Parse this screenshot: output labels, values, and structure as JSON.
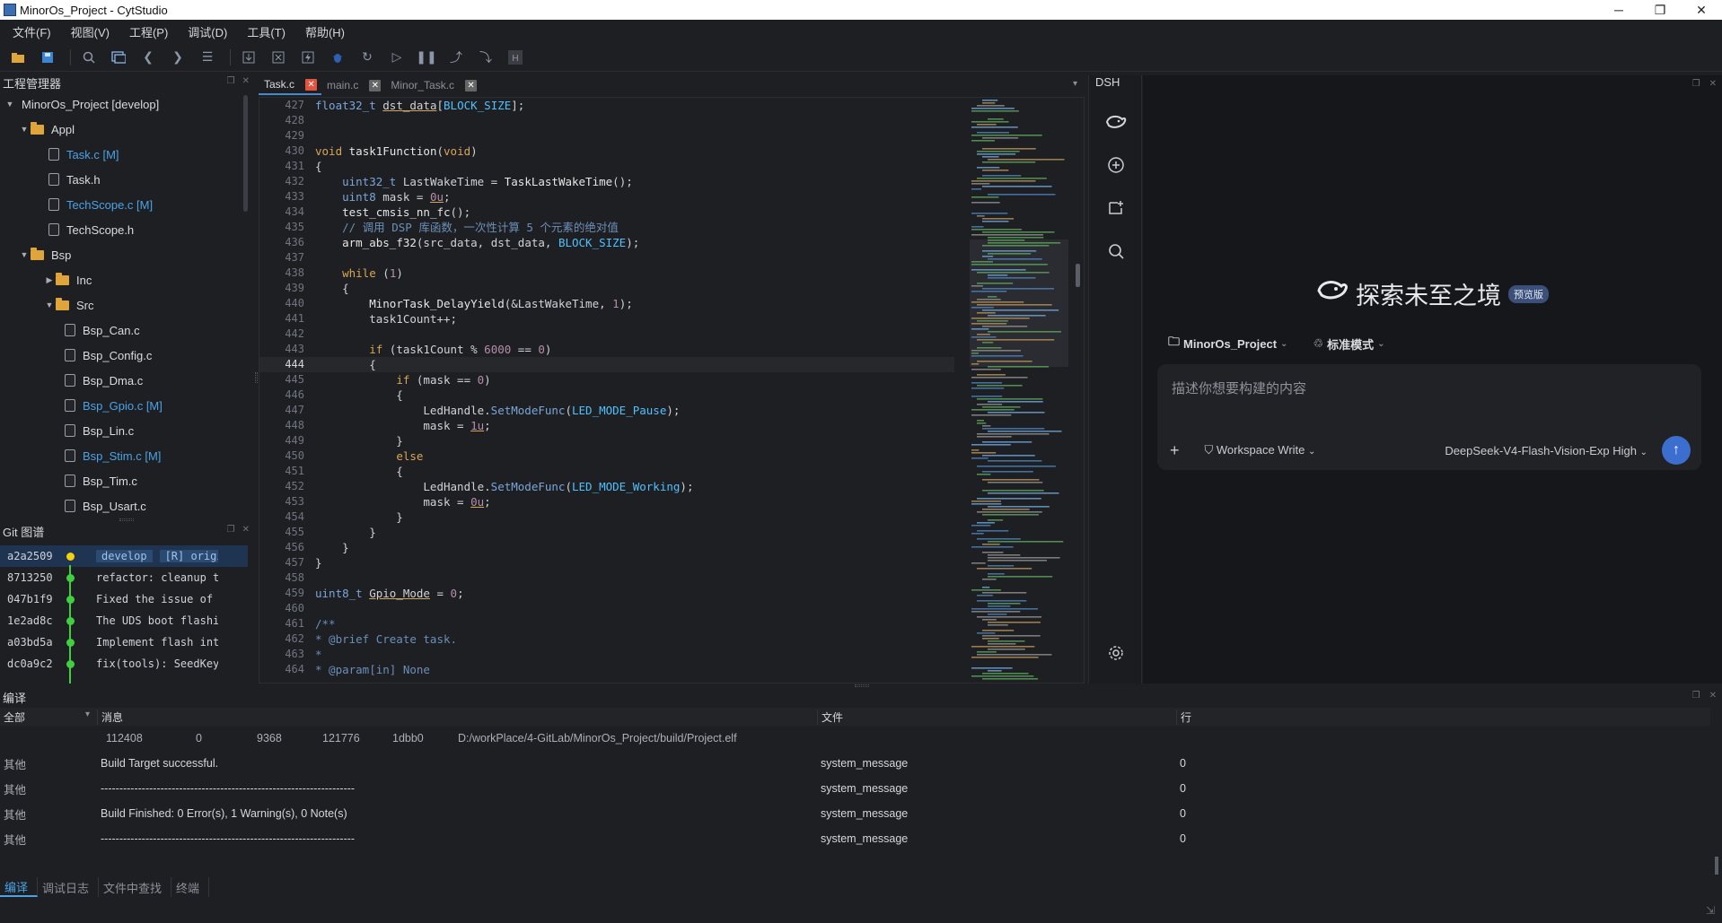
{
  "window": {
    "title": "MinorOs_Project - CytStudio",
    "min": "─",
    "max": "❐",
    "close": "✕"
  },
  "menu": [
    "文件(F)",
    "视图(V)",
    "工程(P)",
    "调试(D)",
    "工具(T)",
    "帮助(H)"
  ],
  "toolbar": {
    "icons": [
      "open-folder-icon",
      "save-icon",
      "search-icon",
      "build-icon",
      "back-icon",
      "forward-icon",
      "settings-sliders-icon",
      "download-icon",
      "erase-icon",
      "flash-icon",
      "debug-icon",
      "refresh-icon",
      "run-icon",
      "pause-icon",
      "step-into-icon",
      "step-out-icon",
      "halt-icon"
    ]
  },
  "project": {
    "title": "工程管理器",
    "items": [
      {
        "label": "MinorOs_Project [develop]",
        "level": 0,
        "kind": "root",
        "open": true
      },
      {
        "label": "Appl",
        "level": 1,
        "kind": "folder",
        "open": true
      },
      {
        "label": "Task.c [M]",
        "level": 2,
        "kind": "file",
        "modified": true
      },
      {
        "label": "Task.h",
        "level": 2,
        "kind": "file"
      },
      {
        "label": "TechScope.c [M]",
        "level": 2,
        "kind": "file",
        "modified": true
      },
      {
        "label": "TechScope.h",
        "level": 2,
        "kind": "file"
      },
      {
        "label": "Bsp",
        "level": 1,
        "kind": "folder",
        "open": true
      },
      {
        "label": "Inc",
        "level": 2,
        "kind": "folder",
        "open": false
      },
      {
        "label": "Src",
        "level": 2,
        "kind": "folder",
        "open": true
      },
      {
        "label": "Bsp_Can.c",
        "level": 3,
        "kind": "file"
      },
      {
        "label": "Bsp_Config.c",
        "level": 3,
        "kind": "file"
      },
      {
        "label": "Bsp_Dma.c",
        "level": 3,
        "kind": "file"
      },
      {
        "label": "Bsp_Gpio.c [M]",
        "level": 3,
        "kind": "file",
        "modified": true
      },
      {
        "label": "Bsp_Lin.c",
        "level": 3,
        "kind": "file"
      },
      {
        "label": "Bsp_Stim.c [M]",
        "level": 3,
        "kind": "file",
        "modified": true
      },
      {
        "label": "Bsp_Tim.c",
        "level": 3,
        "kind": "file"
      },
      {
        "label": "Bsp_Usart.c",
        "level": 3,
        "kind": "file"
      }
    ]
  },
  "git": {
    "title": "Git 图谱",
    "commits": [
      {
        "hash": "a2a2509",
        "branch": "develop",
        "remote": "[R] origi",
        "msg": "",
        "head": true
      },
      {
        "hash": "8713250",
        "msg": "refactor: cleanup t"
      },
      {
        "hash": "047b1f9",
        "msg": "Fixed the issue of"
      },
      {
        "hash": "1e2ad8c",
        "msg": "The UDS boot flashi"
      },
      {
        "hash": "a03bd5a",
        "msg": "Implement flash int"
      },
      {
        "hash": "dc0a9c2",
        "msg": "fix(tools): SeedKey"
      }
    ]
  },
  "editor": {
    "tabs": [
      {
        "label": "Task.c",
        "active": true
      },
      {
        "label": "main.c",
        "active": false
      },
      {
        "label": "Minor_Task.c",
        "active": false
      }
    ],
    "tab_close": "✕",
    "current_line": "444",
    "lines": [
      {
        "n": "427",
        "html": "<span class='ty'>float32_t</span> <span class='ul'>dst_data</span>[<span class='cn'>BLOCK_SIZE</span>];"
      },
      {
        "n": "428",
        "html": ""
      },
      {
        "n": "429",
        "html": ""
      },
      {
        "n": "430",
        "html": "<span class='kw'>void</span> <span class='fn'>task1Function</span>(<span class='kw'>void</span>)"
      },
      {
        "n": "431",
        "html": "{"
      },
      {
        "n": "432",
        "html": "    <span class='ty'>uint32_t</span> LastWakeTime = <span class='fn'>TaskLastWakeTime</span>();"
      },
      {
        "n": "433",
        "html": "    <span class='ty'>uint8</span> mask = <span class='num ul'>0u</span>;"
      },
      {
        "n": "434",
        "html": "    <span class='fn'>test_cmsis_nn_fc</span>();"
      },
      {
        "n": "435",
        "html": "    <span class='cm'>// 调用 DSP 库函数，一次性计算 5 个元素的绝对值</span>"
      },
      {
        "n": "436",
        "html": "    <span class='fn'>arm_abs_f32</span>(src_data, dst_data, <span class='cn'>BLOCK_SIZE</span>);"
      },
      {
        "n": "437",
        "html": ""
      },
      {
        "n": "438",
        "html": "    <span class='kw'>while</span> (<span class='num'>1</span>)"
      },
      {
        "n": "439",
        "html": "    {"
      },
      {
        "n": "440",
        "html": "        <span class='fn'>MinorTask_DelayYield</span>(&amp;LastWakeTime, <span class='num'>1</span>);"
      },
      {
        "n": "441",
        "html": "        task1Count++;"
      },
      {
        "n": "442",
        "html": ""
      },
      {
        "n": "443",
        "html": "        <span class='kw'>if</span> (task1Count % <span class='num'>6000</span> == <span class='num'>0</span>)"
      },
      {
        "n": "444",
        "html": "        {"
      },
      {
        "n": "445",
        "html": "            <span class='kw'>if</span> (mask == <span class='num'>0</span>)"
      },
      {
        "n": "446",
        "html": "            {"
      },
      {
        "n": "447",
        "html": "                LedHandle.<span class='ty'>SetModeFunc</span>(<span class='cn'>LED_MODE_Pause</span>);"
      },
      {
        "n": "448",
        "html": "                mask = <span class='num ul'>1u</span>;"
      },
      {
        "n": "449",
        "html": "            }"
      },
      {
        "n": "450",
        "html": "            <span class='kw'>else</span>"
      },
      {
        "n": "451",
        "html": "            {"
      },
      {
        "n": "452",
        "html": "                LedHandle.<span class='ty'>SetModeFunc</span>(<span class='cn'>LED_MODE_Working</span>);"
      },
      {
        "n": "453",
        "html": "                mask = <span class='num ul'>0u</span>;"
      },
      {
        "n": "454",
        "html": "            }"
      },
      {
        "n": "455",
        "html": "        }"
      },
      {
        "n": "456",
        "html": "    }"
      },
      {
        "n": "457",
        "html": "}"
      },
      {
        "n": "458",
        "html": ""
      },
      {
        "n": "459",
        "html": "<span class='ty'>uint8_t</span> <span class='ul'>Gpio_Mode</span> = <span class='num'>0</span>;"
      },
      {
        "n": "460",
        "html": ""
      },
      {
        "n": "461",
        "html": "<span class='cm'>/**</span>"
      },
      {
        "n": "462",
        "html": "<span class='cm'>* @brief Create task.</span>"
      },
      {
        "n": "463",
        "html": "<span class='cm'>*</span>"
      },
      {
        "n": "464",
        "html": "<span class='cm'>* @param[in] None</span>"
      }
    ]
  },
  "dsh": {
    "title": "DSH",
    "brand": "探索未至之境",
    "badge": "预览版",
    "project_selector": "MinorOs_Project",
    "mode_selector": "标准模式",
    "placeholder": "描述你想要构建的内容",
    "plus": "+",
    "workspace": "Workspace Write",
    "model": "DeepSeek-V4-Flash-Vision-Exp",
    "effort": "High",
    "send": "↑"
  },
  "build": {
    "title": "编译",
    "filter": "全部",
    "columns": {
      "message": "消息",
      "file": "文件",
      "line": "行"
    },
    "size_row": {
      "text": "112408",
      "data": "0",
      "bss": "9368",
      "dec": "121776",
      "hex": "1dbb0",
      "file": "D:/workPlace/4-GitLab/MinorOs_Project/build/Project.elf"
    },
    "rows": [
      {
        "type": "其他",
        "message": "Build Target successful.",
        "file": "system_message",
        "line": "0"
      },
      {
        "type": "其他",
        "message": "--------------------------------------------------------------------",
        "file": "system_message",
        "line": "0"
      },
      {
        "type": "其他",
        "message": "Build Finished: 0 Error(s), 1 Warning(s), 0 Note(s)",
        "file": "system_message",
        "line": "0"
      },
      {
        "type": "其他",
        "message": "--------------------------------------------------------------------",
        "file": "system_message",
        "line": "0"
      }
    ]
  },
  "bottom_tabs": [
    {
      "label": "编译",
      "active": true
    },
    {
      "label": "调试日志",
      "active": false
    },
    {
      "label": "文件中查找",
      "active": false
    },
    {
      "label": "终端",
      "active": false
    }
  ],
  "colors": {
    "accent": "#4aa3e6",
    "modified": "#4aa3e6",
    "git_line": "#3fcf3f",
    "git_head": "#f2d20f",
    "tab_close": "#e2543f"
  }
}
